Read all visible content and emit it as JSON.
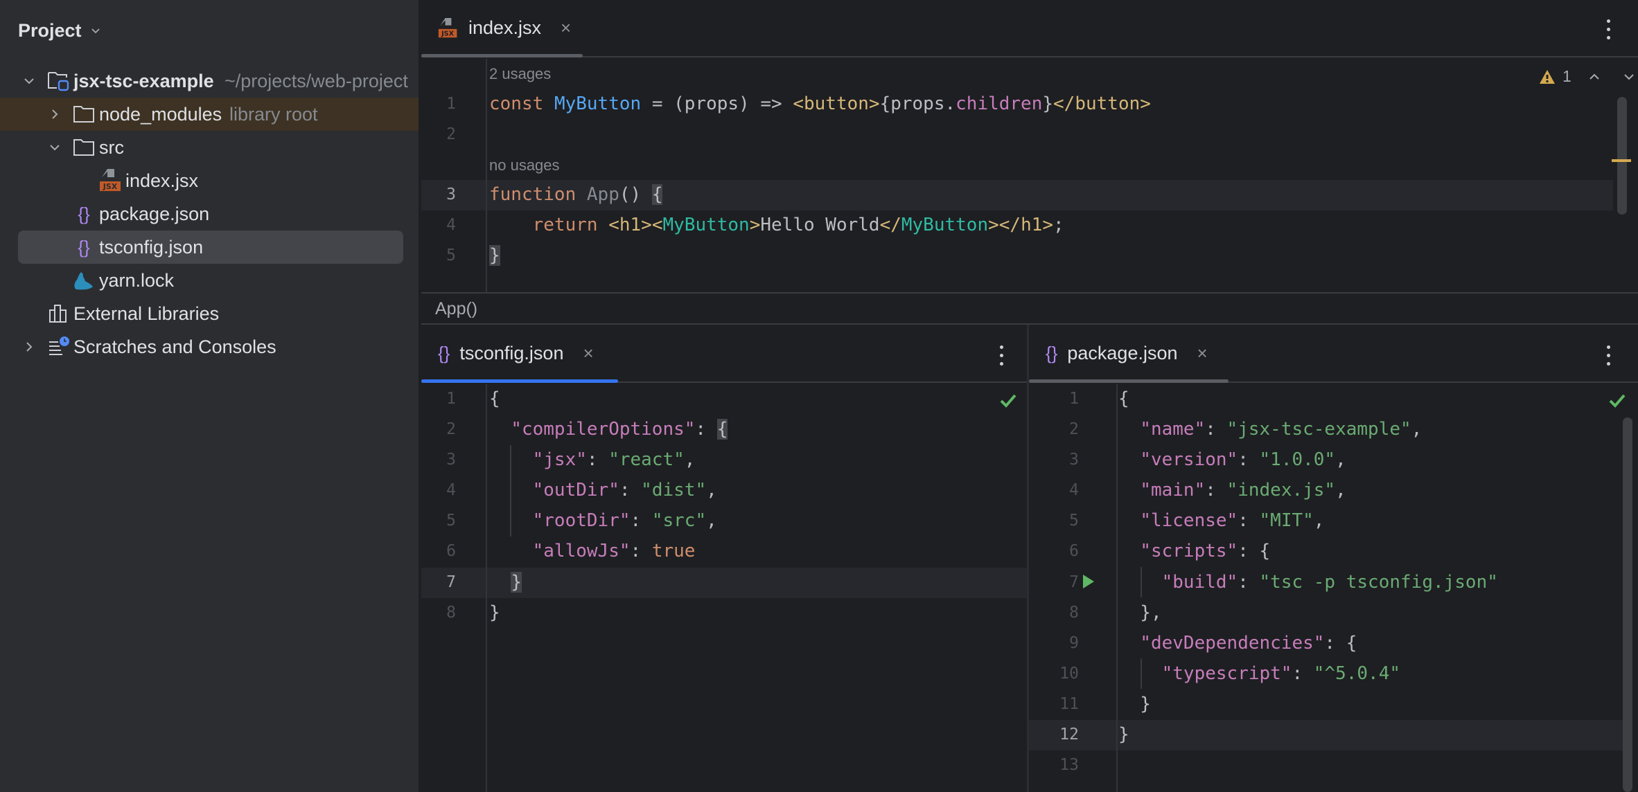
{
  "sidebar": {
    "title": "Project",
    "tree": [
      {
        "label": "jsx-tsc-example",
        "sub": "~/projects/web-projects/jsx-tsc-example",
        "sub_visible": "~/projects/web-project",
        "icon": "project-folder-icon",
        "expanded": true
      },
      {
        "label": "node_modules",
        "sub": "library root",
        "icon": "folder-icon",
        "expanded": false
      },
      {
        "label": "src",
        "icon": "folder-icon",
        "expanded": true
      },
      {
        "label": "index.jsx",
        "icon": "jsx-file-icon"
      },
      {
        "label": "package.json",
        "icon": "json-file-icon"
      },
      {
        "label": "tsconfig.json",
        "icon": "json-file-icon",
        "selected": true
      },
      {
        "label": "yarn.lock",
        "icon": "yarn-icon"
      },
      {
        "label": "External Libraries",
        "icon": "libraries-icon"
      },
      {
        "label": "Scratches and Consoles",
        "icon": "scratches-icon",
        "expanded": false
      }
    ]
  },
  "top_editor": {
    "tab": {
      "label": "index.jsx",
      "icon": "jsx-file-icon",
      "close": "×"
    },
    "inspections": {
      "warning_count": "1"
    },
    "inlays": {
      "usages_1": "2 usages",
      "usages_3": "no usages"
    },
    "lines": [
      {
        "num": "1",
        "tokens": [
          {
            "t": "const",
            "c": "kw"
          },
          {
            "t": " "
          },
          {
            "t": "MyButton",
            "c": "fn"
          },
          {
            "t": " = (props) => "
          },
          {
            "t": "<button>",
            "c": "tag"
          },
          {
            "t": "{props."
          },
          {
            "t": "children",
            "c": "prop"
          },
          {
            "t": "}"
          },
          {
            "t": "</button>",
            "c": "tag"
          }
        ]
      },
      {
        "num": "2",
        "tokens": []
      },
      {
        "num": "3",
        "tokens": [
          {
            "t": "function",
            "c": "kw"
          },
          {
            "t": " "
          },
          {
            "t": "App",
            "c": "dim"
          },
          {
            "t": "() "
          },
          {
            "t": "{",
            "c": "brace-hl"
          }
        ]
      },
      {
        "num": "4",
        "tokens": [
          {
            "t": "    "
          },
          {
            "t": "return",
            "c": "kw"
          },
          {
            "t": " "
          },
          {
            "t": "<h1>",
            "c": "tag"
          },
          {
            "t": "<",
            "c": "tag"
          },
          {
            "t": "MyButton",
            "c": "comp"
          },
          {
            "t": ">",
            "c": "tag"
          },
          {
            "t": "Hello World"
          },
          {
            "t": "</",
            "c": "tag"
          },
          {
            "t": "MyButton",
            "c": "comp"
          },
          {
            "t": ">",
            "c": "tag"
          },
          {
            "t": "</h1>",
            "c": "tag"
          },
          {
            "t": ";"
          }
        ]
      },
      {
        "num": "5",
        "tokens": [
          {
            "t": "}",
            "c": "brace-hl"
          }
        ]
      }
    ],
    "current_line": "3",
    "breadcrumb": "App()"
  },
  "left_editor": {
    "tab": {
      "label": "tsconfig.json",
      "icon": "json-file-icon",
      "close": "×"
    },
    "lines": [
      {
        "num": "1",
        "tokens": [
          {
            "t": "{"
          }
        ]
      },
      {
        "num": "2",
        "tokens": [
          {
            "t": "  "
          },
          {
            "t": "\"compilerOptions\"",
            "c": "prop"
          },
          {
            "t": ": "
          },
          {
            "t": "{",
            "c": "brace-hl"
          }
        ]
      },
      {
        "num": "3",
        "tokens": [
          {
            "t": "    "
          },
          {
            "t": "\"jsx\"",
            "c": "prop"
          },
          {
            "t": ": "
          },
          {
            "t": "\"react\"",
            "c": "str"
          },
          {
            "t": ","
          }
        ]
      },
      {
        "num": "4",
        "tokens": [
          {
            "t": "    "
          },
          {
            "t": "\"outDir\"",
            "c": "prop"
          },
          {
            "t": ": "
          },
          {
            "t": "\"dist\"",
            "c": "str"
          },
          {
            "t": ","
          }
        ]
      },
      {
        "num": "5",
        "tokens": [
          {
            "t": "    "
          },
          {
            "t": "\"rootDir\"",
            "c": "prop"
          },
          {
            "t": ": "
          },
          {
            "t": "\"src\"",
            "c": "str"
          },
          {
            "t": ","
          }
        ]
      },
      {
        "num": "6",
        "tokens": [
          {
            "t": "    "
          },
          {
            "t": "\"allowJs\"",
            "c": "prop"
          },
          {
            "t": ": "
          },
          {
            "t": "true",
            "c": "kw"
          }
        ]
      },
      {
        "num": "7",
        "tokens": [
          {
            "t": "  "
          },
          {
            "t": "}",
            "c": "brace-hl"
          }
        ]
      },
      {
        "num": "8",
        "tokens": [
          {
            "t": "}"
          }
        ]
      }
    ],
    "current_line": "7"
  },
  "right_editor": {
    "tab": {
      "label": "package.json",
      "icon": "json-file-icon",
      "close": "×"
    },
    "lines": [
      {
        "num": "1",
        "tokens": [
          {
            "t": "{"
          }
        ]
      },
      {
        "num": "2",
        "tokens": [
          {
            "t": "  "
          },
          {
            "t": "\"name\"",
            "c": "prop"
          },
          {
            "t": ": "
          },
          {
            "t": "\"jsx-tsc-example\"",
            "c": "str"
          },
          {
            "t": ","
          }
        ]
      },
      {
        "num": "3",
        "tokens": [
          {
            "t": "  "
          },
          {
            "t": "\"version\"",
            "c": "prop"
          },
          {
            "t": ": "
          },
          {
            "t": "\"1.0.0\"",
            "c": "str"
          },
          {
            "t": ","
          }
        ]
      },
      {
        "num": "4",
        "tokens": [
          {
            "t": "  "
          },
          {
            "t": "\"main\"",
            "c": "prop"
          },
          {
            "t": ": "
          },
          {
            "t": "\"index.js\"",
            "c": "str"
          },
          {
            "t": ","
          }
        ]
      },
      {
        "num": "5",
        "tokens": [
          {
            "t": "  "
          },
          {
            "t": "\"license\"",
            "c": "prop"
          },
          {
            "t": ": "
          },
          {
            "t": "\"MIT\"",
            "c": "str"
          },
          {
            "t": ","
          }
        ]
      },
      {
        "num": "6",
        "tokens": [
          {
            "t": "  "
          },
          {
            "t": "\"scripts\"",
            "c": "prop"
          },
          {
            "t": ": {"
          }
        ]
      },
      {
        "num": "7",
        "tokens": [
          {
            "t": "    "
          },
          {
            "t": "\"build\"",
            "c": "prop"
          },
          {
            "t": ": "
          },
          {
            "t": "\"tsc -p tsconfig.json\"",
            "c": "str"
          }
        ],
        "run_gutter": true
      },
      {
        "num": "8",
        "tokens": [
          {
            "t": "  },"
          }
        ]
      },
      {
        "num": "9",
        "tokens": [
          {
            "t": "  "
          },
          {
            "t": "\"devDependencies\"",
            "c": "prop"
          },
          {
            "t": ": {"
          }
        ]
      },
      {
        "num": "10",
        "tokens": [
          {
            "t": "    "
          },
          {
            "t": "\"typescript\"",
            "c": "prop"
          },
          {
            "t": ": "
          },
          {
            "t": "\"^5.0.4\"",
            "c": "str"
          }
        ]
      },
      {
        "num": "11",
        "tokens": [
          {
            "t": "  }"
          }
        ]
      },
      {
        "num": "12",
        "tokens": [
          {
            "t": "}"
          }
        ]
      },
      {
        "num": "13",
        "tokens": []
      }
    ],
    "current_line": "12"
  },
  "colors": {
    "accent_tab_underline": "#3574f0",
    "inactive_tab_underline": "#5a5d63",
    "warning": "#d5aa4f",
    "ok_check": "#5fb865",
    "library_root_bg": "#3d3223"
  }
}
